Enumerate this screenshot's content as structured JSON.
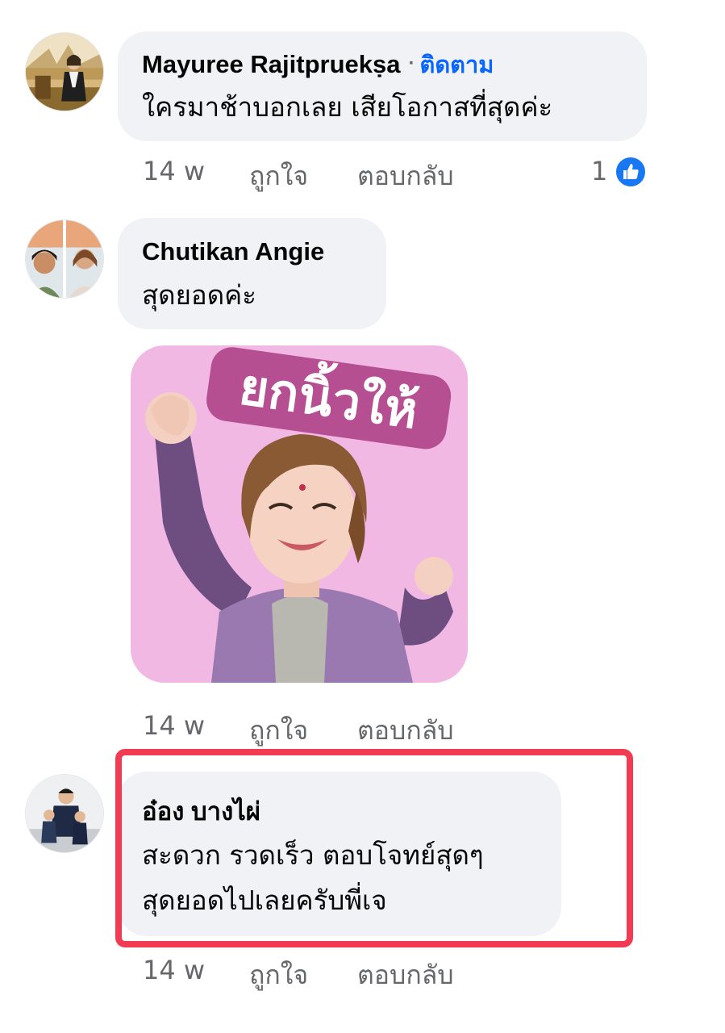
{
  "comments": [
    {
      "author": "Mayuree Rajitpruekṣa",
      "follow_label": "ติดตาม",
      "separator": "·",
      "text_lines": [
        "ใครมาช้าบอกเลย เสียโอกาสที่สุดค่ะ"
      ],
      "time": "14 w",
      "like_label": "ถูกใจ",
      "reply_label": "ตอบกลับ",
      "reaction_count": "1",
      "reaction_icon": "thumbs-up-icon"
    },
    {
      "author": "Chutikan Angie",
      "text_lines": [
        "สุดยอดค่ะ"
      ],
      "sticker_text": "ยกนิ้วให้",
      "time": "14 w",
      "like_label": "ถูกใจ",
      "reply_label": "ตอบกลับ"
    },
    {
      "author": "อ๋อง บางไผ่",
      "text_lines": [
        "สะดวก รวดเร็ว ตอบโจทย์สุดๆ",
        "สุดยอดไปเลยครับพี่เจ"
      ],
      "time": "14 w",
      "like_label": "ถูกใจ",
      "reply_label": "ตอบกลับ",
      "highlighted": true
    }
  ],
  "colors": {
    "bubble": "#f0f2f5",
    "link_blue": "#0866ff",
    "meta_gray": "#65676b",
    "highlight_red": "#f23a52",
    "sticker_pink": "#f1b8e4",
    "sticker_text_bg": "#b64f91"
  }
}
